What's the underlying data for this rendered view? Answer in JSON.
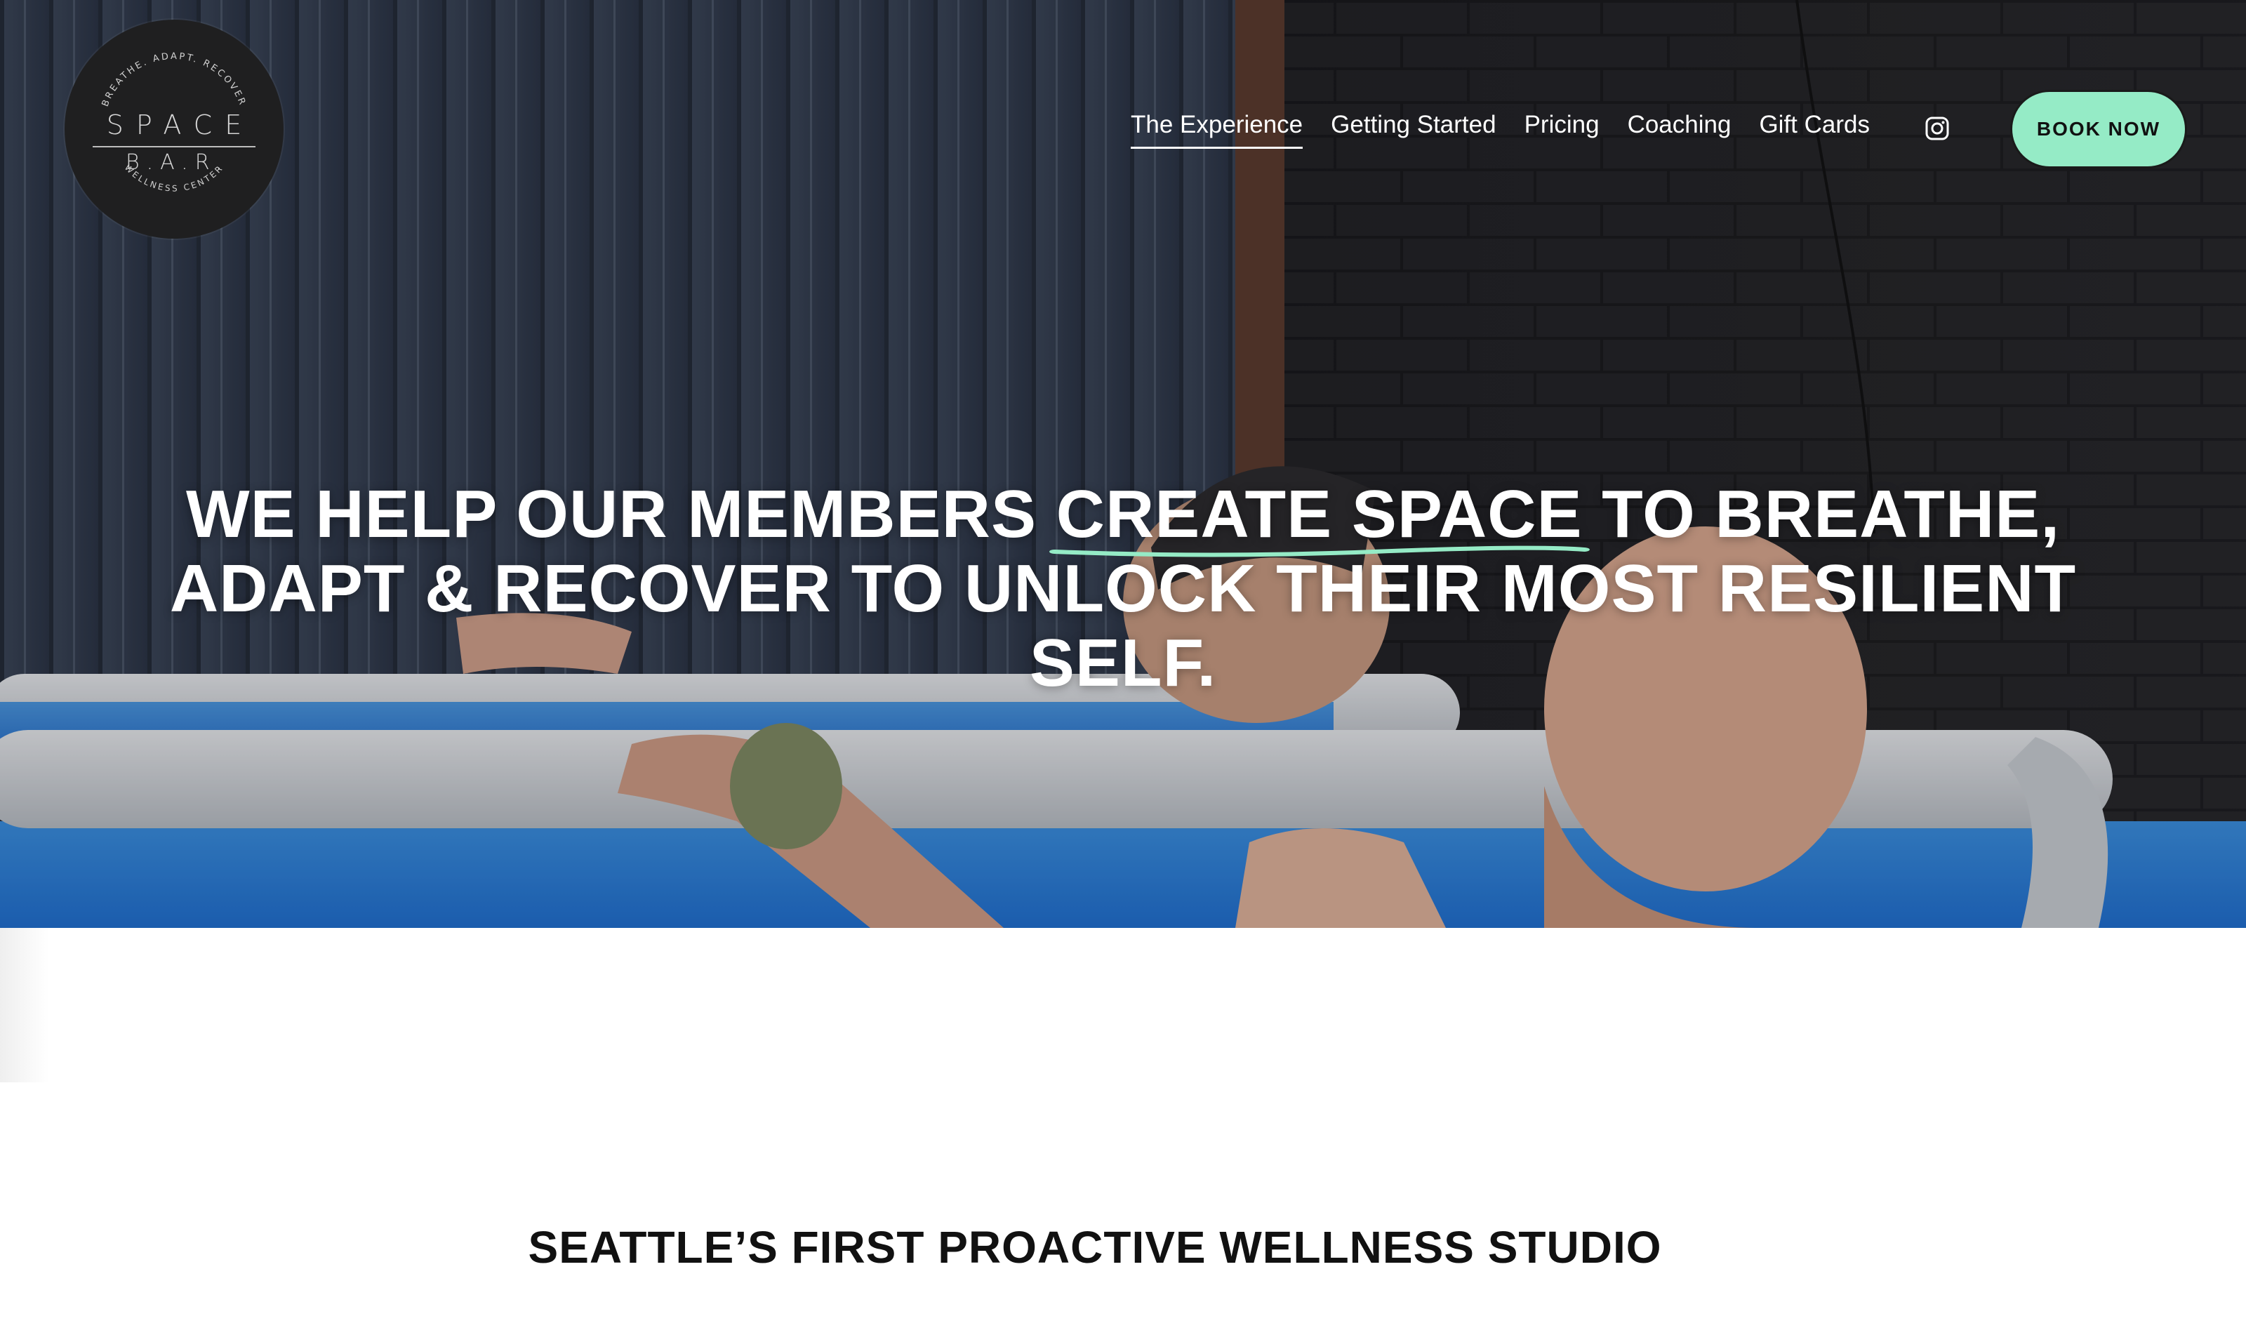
{
  "brand": {
    "logo_top_arc": "BREATHE. ADAPT. RECOVER",
    "logo_word_1": "SPACE",
    "logo_word_2": "B.A.R.",
    "logo_bottom_arc": "WELLNESS CENTER"
  },
  "nav": {
    "items": [
      {
        "label": "The Experience",
        "active": true
      },
      {
        "label": "Getting Started",
        "active": false
      },
      {
        "label": "Pricing",
        "active": false
      },
      {
        "label": "Coaching",
        "active": false
      },
      {
        "label": "Gift Cards",
        "active": false
      }
    ],
    "social_icon": "instagram-icon",
    "cta_label": "BOOK NOW",
    "cta_color": "#95ebc6"
  },
  "hero": {
    "headline_pre": "WE HELP OUR MEMBERS ",
    "headline_highlight": "CREATE SPACE",
    "headline_post": " TO BREATHE, ADAPT & RECOVER TO UNLOCK THEIR MOST RESILIENT SELF.",
    "highlight_color": "#95ebc6"
  },
  "section": {
    "title": "SEATTLE’S FIRST PROACTIVE WELLNESS STUDIO"
  }
}
